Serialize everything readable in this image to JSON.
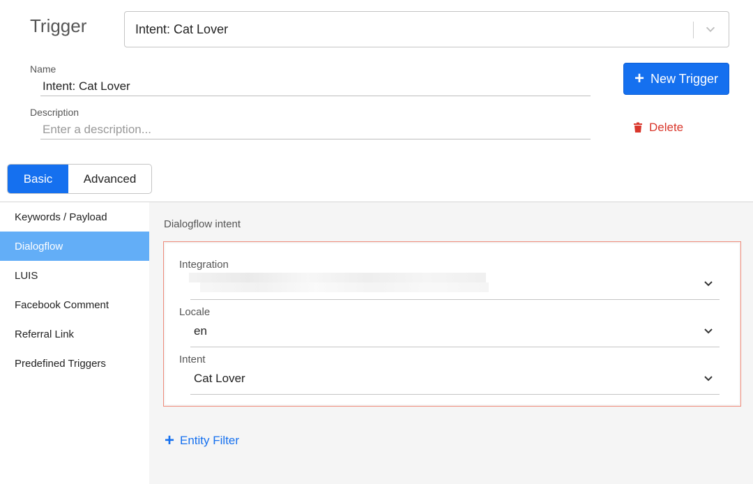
{
  "header": {
    "title": "Trigger",
    "trigger_select_value": "Intent: Cat Lover"
  },
  "form": {
    "name_label": "Name",
    "name_value": "Intent: Cat Lover",
    "description_label": "Description",
    "description_placeholder": "Enter a description...",
    "new_trigger_label": "New Trigger",
    "delete_label": "Delete"
  },
  "tabs": [
    {
      "label": "Basic",
      "active": true
    },
    {
      "label": "Advanced",
      "active": false
    }
  ],
  "sidebar": {
    "items": [
      {
        "label": "Keywords / Payload"
      },
      {
        "label": "Dialogflow",
        "active": true
      },
      {
        "label": "LUIS"
      },
      {
        "label": "Facebook Comment"
      },
      {
        "label": "Referral Link"
      },
      {
        "label": "Predefined Triggers"
      }
    ]
  },
  "main": {
    "section_title": "Dialogflow intent",
    "integration_label": "Integration",
    "locale_label": "Locale",
    "locale_value": "en",
    "intent_label": "Intent",
    "intent_value": "Cat Lover",
    "entity_filter_label": "Entity Filter"
  },
  "colors": {
    "accent": "#1570ef",
    "active_sidebar": "#63aef7",
    "danger": "#d9362b",
    "card_border": "#ef8a7a"
  }
}
